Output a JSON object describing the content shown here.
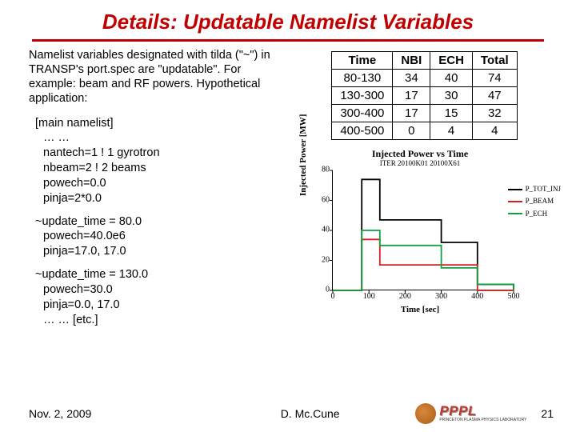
{
  "title": "Details: Updatable Namelist Variables",
  "intro": "Namelist variables designated with tilda (\"~\") in TRANSP's port.spec are \"updatable\". For example: beam and RF powers. Hypothetical application:",
  "code": {
    "l0": "[main namelist]",
    "l1": "… …",
    "l2": "nantech=1  ! 1 gyrotron",
    "l3": "nbeam=2    ! 2 beams",
    "l4": "powech=0.0",
    "l5": "pinja=2*0.0",
    "u1a": "~update_time = 80.0",
    "u1b": "powech=40.0e6",
    "u1c": "pinja=17.0, 17.0",
    "u2a": "~update_time = 130.0",
    "u2b": "powech=30.0",
    "u2c": "pinja=0.0, 17.0",
    "u2d": "… … [etc.]"
  },
  "table": {
    "h": {
      "c0": "Time",
      "c1": "NBI",
      "c2": "ECH",
      "c3": "Total"
    },
    "r0": {
      "c0": "80-130",
      "c1": "34",
      "c2": "40",
      "c3": "74"
    },
    "r1": {
      "c0": "130-300",
      "c1": "17",
      "c2": "30",
      "c3": "47"
    },
    "r2": {
      "c0": "300-400",
      "c1": "17",
      "c2": "15",
      "c3": "32"
    },
    "r3": {
      "c0": "400-500",
      "c1": "0",
      "c2": "4",
      "c3": "4"
    }
  },
  "chart_data": {
    "type": "line",
    "title": "Injected Power vs Time",
    "subtitle": "ITER 20100K01 20100X61",
    "xlabel": "Time [sec]",
    "ylabel": "Injected Power [MW]",
    "xlim": [
      0,
      500
    ],
    "ylim": [
      0,
      80
    ],
    "xticks": [
      0,
      100,
      200,
      300,
      400,
      500
    ],
    "yticks": [
      0,
      20,
      40,
      60,
      80
    ],
    "series": [
      {
        "name": "P_TOT_INJ",
        "color": "#000000",
        "x": [
          0,
          80,
          80,
          130,
          130,
          300,
          300,
          400,
          400,
          500,
          500
        ],
        "y": [
          0,
          0,
          74,
          74,
          47,
          47,
          32,
          32,
          4,
          4,
          0
        ]
      },
      {
        "name": "P_BEAM",
        "color": "#d02020",
        "x": [
          0,
          80,
          80,
          130,
          130,
          300,
          300,
          400,
          400,
          500,
          500
        ],
        "y": [
          0,
          0,
          34,
          34,
          17,
          17,
          17,
          17,
          0,
          0,
          0
        ]
      },
      {
        "name": "P_ECH",
        "color": "#10a040",
        "x": [
          0,
          80,
          80,
          130,
          130,
          300,
          300,
          400,
          400,
          500,
          500
        ],
        "y": [
          0,
          0,
          40,
          40,
          30,
          30,
          15,
          15,
          4,
          4,
          0
        ]
      }
    ],
    "legend": {
      "l0": "P_TOT_INJ",
      "l1": "P_BEAM",
      "l2": "P_ECH"
    }
  },
  "footer": {
    "date": "Nov. 2, 2009",
    "author": "D. Mc.Cune",
    "logo_text": "PPPL",
    "logo_sub": "PRINCETON PLASMA PHYSICS LABORATORY",
    "page": "21"
  }
}
